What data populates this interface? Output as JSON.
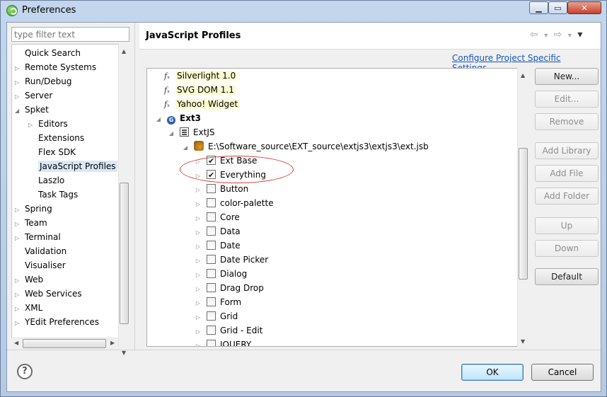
{
  "window": {
    "title": "Preferences",
    "minimize_glyph": "▁",
    "maximize_glyph": "▭",
    "close_glyph": "✕"
  },
  "filter": {
    "placeholder": "type filter text"
  },
  "left_tree": {
    "items": [
      {
        "label": "Quick Search",
        "depth": 0,
        "arrow": ""
      },
      {
        "label": "Remote Systems",
        "depth": 0,
        "arrow": "▷"
      },
      {
        "label": "Run/Debug",
        "depth": 0,
        "arrow": "▷"
      },
      {
        "label": "Server",
        "depth": 0,
        "arrow": "▷"
      },
      {
        "label": "Spket",
        "depth": 0,
        "arrow": "◢"
      },
      {
        "label": "Editors",
        "depth": 1,
        "arrow": "▷"
      },
      {
        "label": "Extensions",
        "depth": 1,
        "arrow": ""
      },
      {
        "label": "Flex SDK",
        "depth": 1,
        "arrow": ""
      },
      {
        "label": "JavaScript Profiles",
        "depth": 1,
        "arrow": "",
        "selected": true
      },
      {
        "label": "Laszlo",
        "depth": 1,
        "arrow": ""
      },
      {
        "label": "Task Tags",
        "depth": 1,
        "arrow": ""
      },
      {
        "label": "Spring",
        "depth": 0,
        "arrow": "▷"
      },
      {
        "label": "Team",
        "depth": 0,
        "arrow": "▷"
      },
      {
        "label": "Terminal",
        "depth": 0,
        "arrow": "▷"
      },
      {
        "label": "Validation",
        "depth": 0,
        "arrow": ""
      },
      {
        "label": "Visualiser",
        "depth": 0,
        "arrow": ""
      },
      {
        "label": "Web",
        "depth": 0,
        "arrow": "▷"
      },
      {
        "label": "Web Services",
        "depth": 0,
        "arrow": "▷"
      },
      {
        "label": "XML",
        "depth": 0,
        "arrow": "▷"
      },
      {
        "label": "YEdit Preferences",
        "depth": 0,
        "arrow": "▷"
      }
    ]
  },
  "header": {
    "title": "JavaScript Profiles",
    "back_glyph": "⇦",
    "forward_glyph": "⇨",
    "menu_glyph": "▾"
  },
  "config_link": "Configure Project Specific Settings...",
  "profiles": {
    "rows": [
      {
        "kind": "fx",
        "label": "Silverlight 1.0",
        "depth": 0
      },
      {
        "kind": "fx",
        "label": "SVG DOM 1.1",
        "depth": 0
      },
      {
        "kind": "fx",
        "label": "Yahoo! Widget",
        "depth": 0
      },
      {
        "kind": "profile",
        "label": "Ext3",
        "depth": 0,
        "arrow": "◢"
      },
      {
        "kind": "library",
        "label": "ExtJS",
        "depth": 1,
        "arrow": "◢"
      },
      {
        "kind": "jsb",
        "label": "E:\\Software_source\\EXT_source\\extjs3\\extjs3\\ext.jsb",
        "depth": 2,
        "arrow": "◢"
      },
      {
        "kind": "check",
        "label": "Ext Base",
        "checked": true
      },
      {
        "kind": "check",
        "label": "Everything",
        "checked": true
      },
      {
        "kind": "check",
        "label": "Button",
        "checked": false
      },
      {
        "kind": "check",
        "label": "color-palette",
        "checked": false
      },
      {
        "kind": "check",
        "label": "Core",
        "checked": false
      },
      {
        "kind": "check",
        "label": "Data",
        "checked": false
      },
      {
        "kind": "check",
        "label": "Date",
        "checked": false
      },
      {
        "kind": "check",
        "label": "Date Picker",
        "checked": false
      },
      {
        "kind": "check",
        "label": "Dialog",
        "checked": false
      },
      {
        "kind": "check",
        "label": "Drag Drop",
        "checked": false
      },
      {
        "kind": "check",
        "label": "Form",
        "checked": false
      },
      {
        "kind": "check",
        "label": "Grid",
        "checked": false
      },
      {
        "kind": "check",
        "label": "Grid - Edit",
        "checked": false
      },
      {
        "kind": "check",
        "label": "JQUERY",
        "checked": false
      }
    ]
  },
  "side_buttons": [
    {
      "label": "New...",
      "enabled": true
    },
    {
      "label": "Edit...",
      "enabled": false
    },
    {
      "label": "Remove",
      "enabled": false
    },
    {
      "label": "Add Library",
      "enabled": false
    },
    {
      "label": "Add File",
      "enabled": false
    },
    {
      "label": "Add Folder",
      "enabled": false
    },
    {
      "label": "Up",
      "enabled": false
    },
    {
      "label": "Down",
      "enabled": false
    },
    {
      "label": "Default",
      "enabled": true
    }
  ],
  "dialog": {
    "help_glyph": "?",
    "ok_label": "OK",
    "cancel_label": "Cancel"
  },
  "colors": {
    "selection": "#dbe8f6",
    "link": "#1755c4",
    "annotation": "#d93a3a",
    "fx_highlight": "#fdfbd0"
  }
}
